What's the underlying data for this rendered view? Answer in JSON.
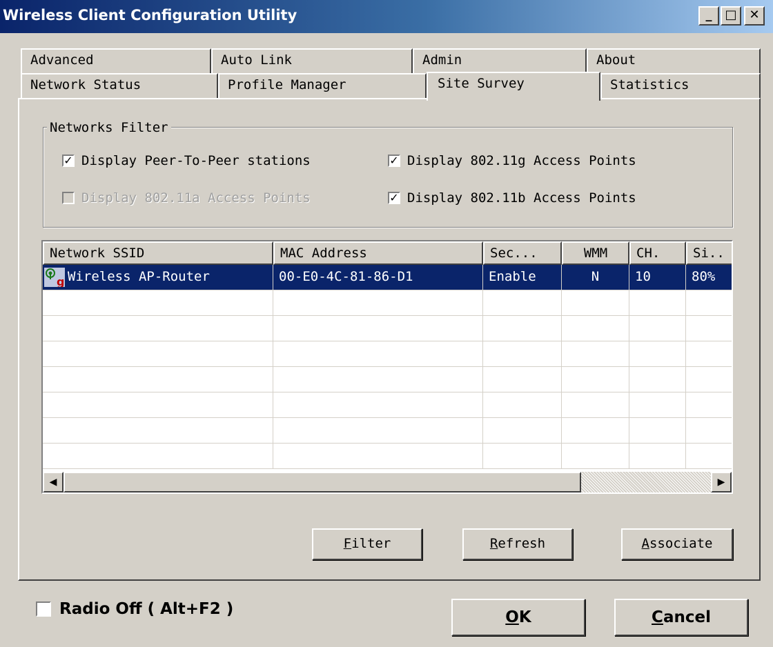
{
  "window": {
    "title": "Wireless Client Configuration Utility",
    "minimize_glyph": "_",
    "maximize_glyph": "□",
    "close_glyph": "✕"
  },
  "tabs_row1": [
    {
      "label": "Advanced"
    },
    {
      "label": "Auto Link"
    },
    {
      "label": "Admin"
    },
    {
      "label": "About"
    }
  ],
  "tabs_row2": [
    {
      "label": "Network Status"
    },
    {
      "label": "Profile Manager"
    },
    {
      "label": "Site Survey",
      "active": true
    },
    {
      "label": "Statistics"
    }
  ],
  "filter": {
    "legend": "Networks Filter",
    "options": [
      {
        "label": "Display Peer-To-Peer stations",
        "checked": true,
        "enabled": true
      },
      {
        "label": "Display 802.11g Access Points",
        "checked": true,
        "enabled": true
      },
      {
        "label": "Display 802.11a Access Points",
        "checked": false,
        "enabled": false
      },
      {
        "label": "Display 802.11b Access Points",
        "checked": true,
        "enabled": true
      }
    ]
  },
  "list": {
    "columns": [
      "Network SSID",
      "MAC Address",
      "Sec...",
      "WMM",
      "CH.",
      "Si.."
    ],
    "rows": [
      {
        "ssid": "Wireless AP-Router",
        "mac": "00-E0-4C-81-86-D1",
        "security": "Enable",
        "wmm": "N",
        "channel": "10",
        "signal": "80%",
        "selected": true,
        "icon": "access-point-icon",
        "icon_badge": "g"
      }
    ],
    "empty_rows": 7,
    "scroll_left_glyph": "◀",
    "scroll_right_glyph": "▶"
  },
  "buttons": {
    "filter": {
      "underline": "F",
      "rest": "ilter"
    },
    "refresh": {
      "underline": "R",
      "rest": "efresh"
    },
    "associate": {
      "underline": "A",
      "rest": "ssociate"
    }
  },
  "footer": {
    "radio_off_label": "Radio Off  ( Alt+F2 )",
    "radio_off_checked": false,
    "ok": {
      "underline": "O",
      "rest": "K"
    },
    "cancel": {
      "underline": "C",
      "rest": "ancel"
    }
  }
}
